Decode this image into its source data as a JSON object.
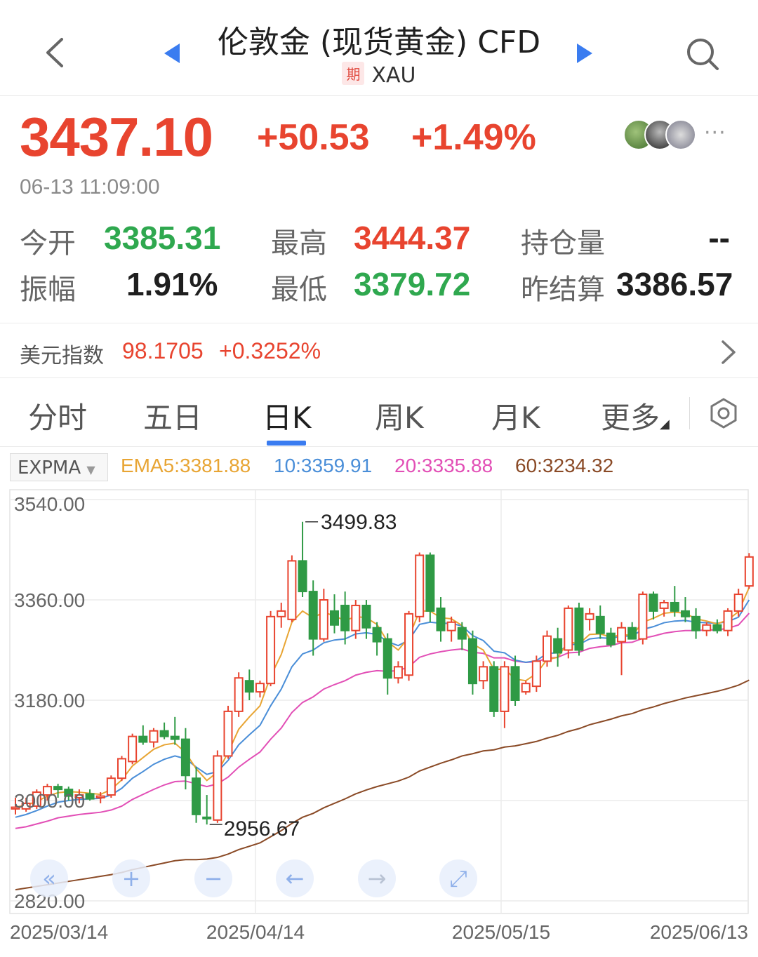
{
  "header": {
    "title": "伦敦金 (现货黄金) CFD",
    "badge": "期",
    "symbol": "XAU"
  },
  "quote": {
    "price": "3437.10",
    "change": "+50.53",
    "change_pct": "+1.49%",
    "timestamp": "06-13 11:09:00",
    "more": "···"
  },
  "stats": {
    "open_label": "今开",
    "open_value": "3385.31",
    "high_label": "最高",
    "high_value": "3444.37",
    "oi_label": "持仓量",
    "oi_value": "--",
    "amp_label": "振幅",
    "amp_value": "1.91%",
    "low_label": "最低",
    "low_value": "3379.72",
    "prev_label": "昨结算",
    "prev_value": "3386.57"
  },
  "usd_index": {
    "label": "美元指数",
    "value": "98.1705",
    "change": "+0.3252%"
  },
  "tabs": [
    "分时",
    "五日",
    "日K",
    "周K",
    "月K",
    "更多"
  ],
  "active_tab": "日K",
  "indicator": {
    "name": "EXPMA",
    "ema5": "EMA5:3381.88",
    "ema10": "10:3359.91",
    "ema20": "20:3335.88",
    "ema60": "60:3234.32"
  },
  "colors": {
    "up": "#e8442f",
    "down": "#2f9a45",
    "ema5": "#e8a534",
    "ema10": "#4a8ed8",
    "ema20": "#e24fb6",
    "ema60": "#8a4a26",
    "accent": "#3a7cf0"
  },
  "chart_data": {
    "type": "candlestick",
    "y_ticks": [
      "3540.00",
      "3360.00",
      "3180.00",
      "3000.00",
      "2820.00"
    ],
    "ylim": [
      2820,
      3540
    ],
    "x_ticks": [
      "2025/03/14",
      "2025/04/14",
      "2025/05/15",
      "2025/06/13"
    ],
    "high_mark": "3499.83",
    "low_mark": "2956.67",
    "candles": [
      {
        "o": 2985,
        "h": 3005,
        "l": 2975,
        "c": 2988
      },
      {
        "o": 2985,
        "h": 3005,
        "l": 2980,
        "c": 2995
      },
      {
        "o": 2990,
        "h": 3020,
        "l": 2985,
        "c": 3015
      },
      {
        "o": 3010,
        "h": 3030,
        "l": 3000,
        "c": 3025
      },
      {
        "o": 3025,
        "h": 3030,
        "l": 3005,
        "c": 3020
      },
      {
        "o": 3020,
        "h": 3025,
        "l": 3000,
        "c": 3008
      },
      {
        "o": 3005,
        "h": 3020,
        "l": 2995,
        "c": 3010
      },
      {
        "o": 3012,
        "h": 3020,
        "l": 3000,
        "c": 3003
      },
      {
        "o": 3005,
        "h": 3015,
        "l": 2995,
        "c": 3008
      },
      {
        "o": 3010,
        "h": 3045,
        "l": 3005,
        "c": 3040
      },
      {
        "o": 3040,
        "h": 3080,
        "l": 3035,
        "c": 3075
      },
      {
        "o": 3070,
        "h": 3120,
        "l": 3065,
        "c": 3115
      },
      {
        "o": 3115,
        "h": 3135,
        "l": 3100,
        "c": 3105
      },
      {
        "o": 3105,
        "h": 3130,
        "l": 3095,
        "c": 3125
      },
      {
        "o": 3125,
        "h": 3140,
        "l": 3110,
        "c": 3115
      },
      {
        "o": 3115,
        "h": 3150,
        "l": 3100,
        "c": 3110
      },
      {
        "o": 3110,
        "h": 3130,
        "l": 3020,
        "c": 3045
      },
      {
        "o": 3040,
        "h": 3060,
        "l": 2960,
        "c": 2975
      },
      {
        "o": 2970,
        "h": 3010,
        "l": 2957,
        "c": 2968
      },
      {
        "o": 2965,
        "h": 3090,
        "l": 2960,
        "c": 3080
      },
      {
        "o": 3080,
        "h": 3170,
        "l": 3075,
        "c": 3160
      },
      {
        "o": 3160,
        "h": 3230,
        "l": 3150,
        "c": 3220
      },
      {
        "o": 3215,
        "h": 3235,
        "l": 3180,
        "c": 3195
      },
      {
        "o": 3195,
        "h": 3215,
        "l": 3185,
        "c": 3210
      },
      {
        "o": 3210,
        "h": 3340,
        "l": 3205,
        "c": 3330
      },
      {
        "o": 3330,
        "h": 3355,
        "l": 3310,
        "c": 3340
      },
      {
        "o": 3325,
        "h": 3440,
        "l": 3320,
        "c": 3430
      },
      {
        "o": 3430,
        "h": 3500,
        "l": 3365,
        "c": 3375
      },
      {
        "o": 3375,
        "h": 3395,
        "l": 3260,
        "c": 3290
      },
      {
        "o": 3290,
        "h": 3380,
        "l": 3285,
        "c": 3360
      },
      {
        "o": 3340,
        "h": 3370,
        "l": 3300,
        "c": 3315
      },
      {
        "o": 3350,
        "h": 3375,
        "l": 3280,
        "c": 3305
      },
      {
        "o": 3305,
        "h": 3360,
        "l": 3290,
        "c": 3350
      },
      {
        "o": 3350,
        "h": 3360,
        "l": 3290,
        "c": 3310
      },
      {
        "o": 3310,
        "h": 3320,
        "l": 3260,
        "c": 3285
      },
      {
        "o": 3290,
        "h": 3300,
        "l": 3190,
        "c": 3220
      },
      {
        "o": 3220,
        "h": 3250,
        "l": 3210,
        "c": 3240
      },
      {
        "o": 3225,
        "h": 3340,
        "l": 3215,
        "c": 3335
      },
      {
        "o": 3330,
        "h": 3445,
        "l": 3320,
        "c": 3440
      },
      {
        "o": 3440,
        "h": 3445,
        "l": 3320,
        "c": 3340
      },
      {
        "o": 3345,
        "h": 3365,
        "l": 3285,
        "c": 3305
      },
      {
        "o": 3305,
        "h": 3330,
        "l": 3285,
        "c": 3320
      },
      {
        "o": 3310,
        "h": 3320,
        "l": 3270,
        "c": 3290
      },
      {
        "o": 3290,
        "h": 3305,
        "l": 3190,
        "c": 3210
      },
      {
        "o": 3215,
        "h": 3250,
        "l": 3200,
        "c": 3240
      },
      {
        "o": 3240,
        "h": 3250,
        "l": 3150,
        "c": 3160
      },
      {
        "o": 3160,
        "h": 3250,
        "l": 3130,
        "c": 3240
      },
      {
        "o": 3240,
        "h": 3260,
        "l": 3170,
        "c": 3180
      },
      {
        "o": 3195,
        "h": 3215,
        "l": 3190,
        "c": 3210
      },
      {
        "o": 3205,
        "h": 3260,
        "l": 3195,
        "c": 3250
      },
      {
        "o": 3250,
        "h": 3305,
        "l": 3240,
        "c": 3295
      },
      {
        "o": 3290,
        "h": 3310,
        "l": 3240,
        "c": 3265
      },
      {
        "o": 3270,
        "h": 3350,
        "l": 3255,
        "c": 3345
      },
      {
        "o": 3345,
        "h": 3355,
        "l": 3260,
        "c": 3270
      },
      {
        "o": 3325,
        "h": 3345,
        "l": 3305,
        "c": 3335
      },
      {
        "o": 3330,
        "h": 3350,
        "l": 3290,
        "c": 3300
      },
      {
        "o": 3300,
        "h": 3310,
        "l": 3275,
        "c": 3280
      },
      {
        "o": 3285,
        "h": 3320,
        "l": 3225,
        "c": 3310
      },
      {
        "o": 3310,
        "h": 3320,
        "l": 3290,
        "c": 3290
      },
      {
        "o": 3290,
        "h": 3375,
        "l": 3280,
        "c": 3370
      },
      {
        "o": 3370,
        "h": 3375,
        "l": 3325,
        "c": 3340
      },
      {
        "o": 3345,
        "h": 3360,
        "l": 3330,
        "c": 3355
      },
      {
        "o": 3355,
        "h": 3385,
        "l": 3330,
        "c": 3340
      },
      {
        "o": 3340,
        "h": 3365,
        "l": 3320,
        "c": 3330
      },
      {
        "o": 3330,
        "h": 3345,
        "l": 3290,
        "c": 3305
      },
      {
        "o": 3305,
        "h": 3320,
        "l": 3295,
        "c": 3315
      },
      {
        "o": 3315,
        "h": 3325,
        "l": 3300,
        "c": 3305
      },
      {
        "o": 3305,
        "h": 3345,
        "l": 3295,
        "c": 3340
      },
      {
        "o": 3340,
        "h": 3380,
        "l": 3330,
        "c": 3370
      },
      {
        "o": 3385,
        "h": 3444,
        "l": 3380,
        "c": 3437
      }
    ],
    "ema5": [
      2988,
      2992,
      2998,
      3008,
      3014,
      3016,
      3015,
      3013,
      3011,
      3020,
      3037,
      3062,
      3077,
      3092,
      3100,
      3103,
      3086,
      3057,
      3036,
      3051,
      3086,
      3128,
      3150,
      3170,
      3223,
      3262,
      3320,
      3340,
      3328,
      3338,
      3331,
      3323,
      3330,
      3328,
      3316,
      3285,
      3270,
      3293,
      3340,
      3340,
      3328,
      3326,
      3314,
      3281,
      3270,
      3235,
      3236,
      3218,
      3215,
      3228,
      3253,
      3257,
      3285,
      3281,
      3298,
      3299,
      3293,
      3298,
      3296,
      3320,
      3327,
      3336,
      3338,
      3336,
      3326,
      3322,
      3317,
      3324,
      3339,
      3382
    ],
    "ema10": [
      2970,
      2975,
      2982,
      2990,
      2997,
      3000,
      3002,
      3003,
      3004,
      3010,
      3022,
      3040,
      3052,
      3065,
      3074,
      3080,
      3075,
      3060,
      3047,
      3052,
      3072,
      3100,
      3118,
      3135,
      3170,
      3200,
      3240,
      3263,
      3270,
      3283,
      3288,
      3290,
      3299,
      3301,
      3298,
      3285,
      3278,
      3288,
      3316,
      3320,
      3318,
      3318,
      3313,
      3296,
      3287,
      3268,
      3265,
      3252,
      3248,
      3251,
      3264,
      3265,
      3280,
      3280,
      3290,
      3292,
      3291,
      3295,
      3295,
      3307,
      3312,
      3319,
      3322,
      3323,
      3320,
      3319,
      3318,
      3321,
      3329,
      3360
    ],
    "ema20": [
      2950,
      2953,
      2958,
      2963,
      2969,
      2972,
      2975,
      2977,
      2979,
      2983,
      2990,
      3002,
      3011,
      3020,
      3028,
      3034,
      3035,
      3030,
      3025,
      3030,
      3042,
      3060,
      3074,
      3087,
      3110,
      3130,
      3158,
      3176,
      3186,
      3200,
      3208,
      3215,
      3225,
      3230,
      3233,
      3232,
      3233,
      3240,
      3257,
      3263,
      3267,
      3270,
      3272,
      3266,
      3264,
      3256,
      3256,
      3250,
      3248,
      3249,
      3255,
      3257,
      3265,
      3266,
      3273,
      3276,
      3278,
      3283,
      3284,
      3291,
      3295,
      3300,
      3303,
      3305,
      3305,
      3306,
      3306,
      3309,
      3315,
      3336
    ],
    "ema60": [
      2840,
      2843,
      2846,
      2849,
      2852,
      2855,
      2858,
      2861,
      2864,
      2867,
      2871,
      2876,
      2880,
      2884,
      2888,
      2892,
      2894,
      2894,
      2895,
      2898,
      2904,
      2912,
      2918,
      2924,
      2935,
      2946,
      2959,
      2970,
      2977,
      2987,
      2995,
      3003,
      3012,
      3019,
      3025,
      3030,
      3035,
      3042,
      3053,
      3060,
      3067,
      3073,
      3080,
      3084,
      3089,
      3091,
      3096,
      3098,
      3102,
      3106,
      3112,
      3117,
      3124,
      3129,
      3136,
      3141,
      3146,
      3152,
      3156,
      3163,
      3168,
      3174,
      3179,
      3184,
      3188,
      3192,
      3196,
      3201,
      3207,
      3216
    ]
  },
  "toolbar": [
    "«",
    "+",
    "−",
    "←",
    "→",
    "⤢"
  ]
}
